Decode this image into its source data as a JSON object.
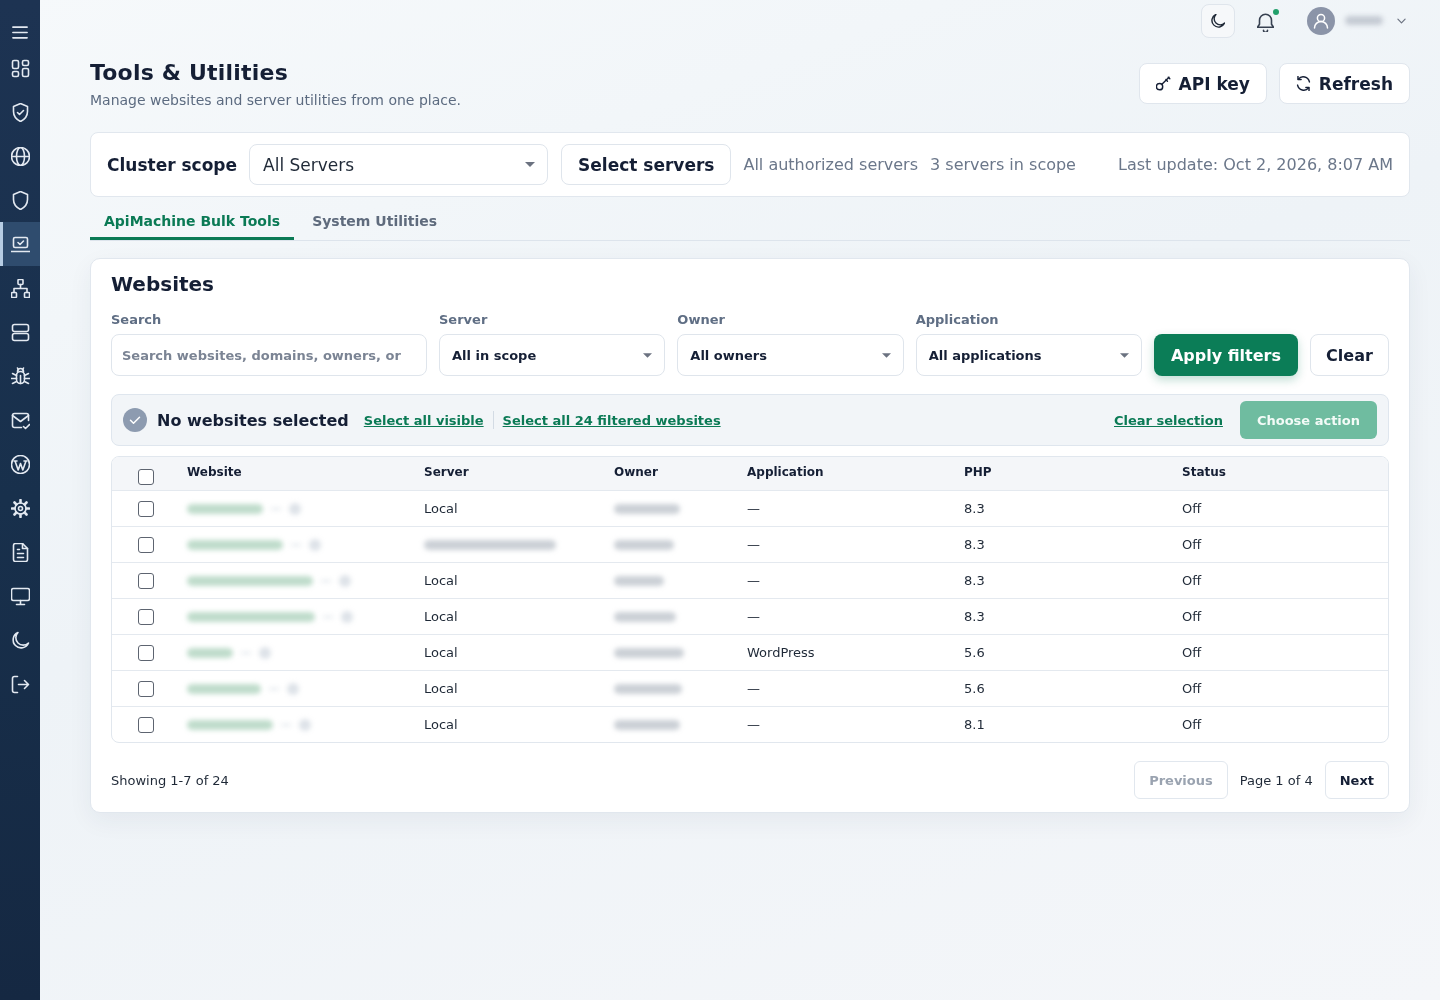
{
  "sidebar": {
    "items": [
      {
        "selected": false
      },
      {
        "selected": false
      },
      {
        "selected": false
      },
      {
        "selected": false
      },
      {
        "selected": true
      },
      {
        "selected": false
      },
      {
        "selected": false
      },
      {
        "selected": false
      },
      {
        "selected": false
      },
      {
        "selected": false
      },
      {
        "selected": false
      },
      {
        "selected": false
      },
      {
        "selected": false
      },
      {
        "selected": false
      },
      {
        "selected": false
      }
    ]
  },
  "topbar": {
    "notification_dot": true
  },
  "header": {
    "title": "Tools & Utilities",
    "subtitle": "Manage websites and server utilities from one place.",
    "buttons": [
      {
        "label": "API key",
        "kind": "key"
      },
      {
        "label": "Refresh",
        "kind": "refresh"
      }
    ]
  },
  "cluster_scope": {
    "label": "Cluster scope",
    "select": {
      "value": "All Servers"
    },
    "button": "Select servers",
    "scope_text": "All authorized servers",
    "count_text": "3 servers in scope",
    "last_update": "Last update: Oct 2, 2026, 8:07 AM"
  },
  "tabs": [
    {
      "label": "ApiMachine Bulk Tools",
      "selected": true
    },
    {
      "label": "System Utilities",
      "selected": false
    }
  ],
  "websites": {
    "title": "Websites",
    "filters": [
      {
        "label": "Search",
        "kind": "search",
        "placeholder": "Search websites, domains, owners, or"
      },
      {
        "label": "Server",
        "kind": "select",
        "value": "All in scope"
      },
      {
        "label": "Owner",
        "kind": "select",
        "value": "All owners"
      },
      {
        "label": "Application",
        "kind": "select",
        "value": "All applications"
      }
    ],
    "apply_button": "Apply filters",
    "clear_button": "Clear",
    "selection": {
      "text": "No websites selected",
      "links": [
        "Select all visible",
        "Select all 24 filtered websites"
      ],
      "clear_link": "Clear selection",
      "action_button": {
        "label": "Choose action",
        "disabled": true
      }
    },
    "table": {
      "select_all_checked": false,
      "columns": [
        "Website",
        "Server",
        "Owner",
        "Application",
        "PHP",
        "Status"
      ],
      "rows": [
        {
          "checked": false,
          "server": "Local",
          "application": "—",
          "php": "8.3",
          "status": "Off"
        },
        {
          "checked": false,
          "application": "—",
          "php": "8.3",
          "status": "Off"
        },
        {
          "checked": false,
          "server": "Local",
          "application": "—",
          "php": "8.3",
          "status": "Off"
        },
        {
          "checked": false,
          "server": "Local",
          "application": "—",
          "php": "8.3",
          "status": "Off"
        },
        {
          "checked": false,
          "server": "Local",
          "application": "WordPress",
          "php": "5.6",
          "status": "Off"
        },
        {
          "checked": false,
          "server": "Local",
          "application": "—",
          "php": "5.6",
          "status": "Off"
        },
        {
          "checked": false,
          "server": "Local",
          "application": "—",
          "php": "8.1",
          "status": "Off"
        }
      ]
    },
    "pagination": {
      "summary": "Showing 1-7 of 24",
      "previous": {
        "label": "Previous",
        "disabled": true
      },
      "page": "Page 1 of 4",
      "next": {
        "label": "Next",
        "disabled": false
      }
    }
  }
}
